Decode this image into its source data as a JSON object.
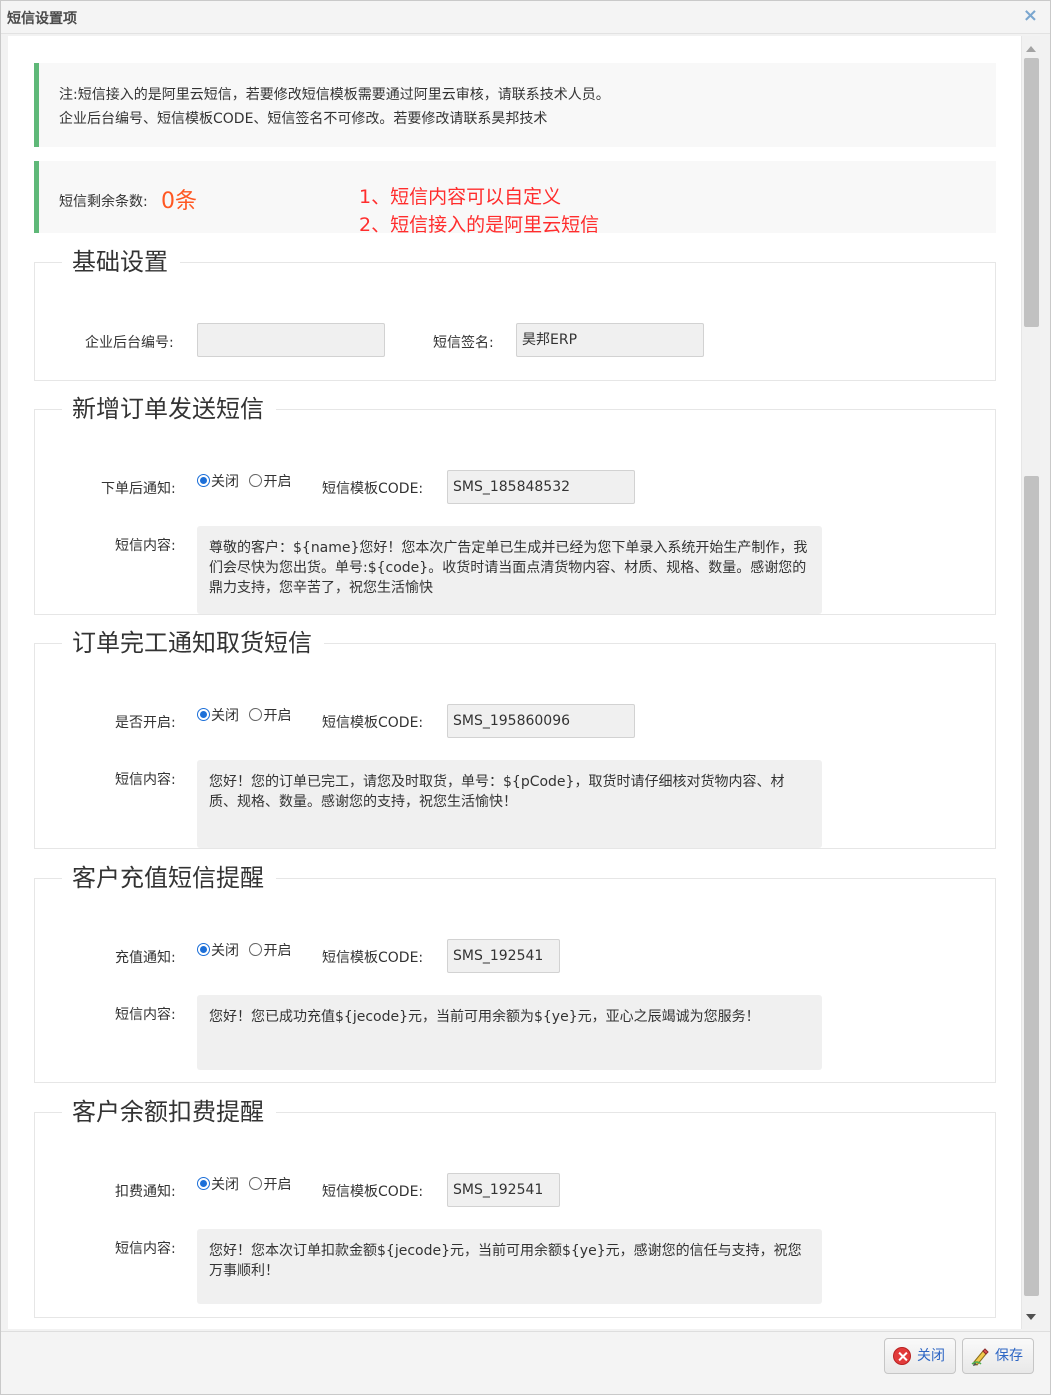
{
  "dialog": {
    "title": "短信设置项",
    "close_glyph": "×"
  },
  "notice": {
    "line1": "注:短信接入的是阿里云短信，若要修改短信模板需要通过阿里云审核，请联系技术人员。",
    "line2": "企业后台编号、短信模板CODE、短信签名不可修改。若要修改请联系昊邦技术",
    "remaining_label": "短信剩余条数:",
    "remaining_count": "0条",
    "red_note_1": "1、短信内容可以自定义",
    "red_note_2": "2、短信接入的是阿里云短信"
  },
  "sections": {
    "basic": {
      "legend": "基础设置",
      "company_id_label": "企业后台编号:",
      "company_id_value": "",
      "signature_label": "短信签名:",
      "signature_value": "昊邦ERP"
    },
    "new_order": {
      "legend": "新增订单发送短信",
      "toggle_label": "下单后通知:",
      "off_label": "关闭",
      "on_label": "开启",
      "code_label": "短信模板CODE:",
      "code_value": "SMS_185848532",
      "content_label": "短信内容:",
      "content": "尊敬的客户：${name}您好！您本次广告定单已生成并已经为您下单录入系统开始生产制作，我们会尽快为您出货。单号:${code}。收货时请当面点清货物内容、材质、规格、数量。感谢您的鼎力支持，您辛苦了，祝您生活愉快"
    },
    "order_done": {
      "legend": "订单完工通知取货短信",
      "toggle_label": "是否开启:",
      "off_label": "关闭",
      "on_label": "开启",
      "code_label": "短信模板CODE:",
      "code_value": "SMS_195860096",
      "content_label": "短信内容:",
      "content": "您好！您的订单已完工，请您及时取货，单号：${pCode}，取货时请仔细核对货物内容、材质、规格、数量。感谢您的支持，祝您生活愉快！"
    },
    "recharge": {
      "legend": "客户充值短信提醒",
      "toggle_label": "充值通知:",
      "off_label": "关闭",
      "on_label": "开启",
      "code_label": "短信模板CODE:",
      "code_value": "SMS_192541",
      "content_label": "短信内容:",
      "content": "您好！您已成功充值${jecode}元，当前可用余额为${ye}元，亚心之辰竭诚为您服务！"
    },
    "deduct": {
      "legend": "客户余额扣费提醒",
      "toggle_label": "扣费通知:",
      "off_label": "关闭",
      "on_label": "开启",
      "code_label": "短信模板CODE:",
      "code_value": "SMS_192541",
      "content_label": "短信内容:",
      "content": "您好！您本次订单扣款金额${jecode}元，当前可用余额${ye}元，感谢您的信任与支持，祝您万事顺利！"
    }
  },
  "footer": {
    "close_label": "关闭",
    "save_label": "保存"
  },
  "colors": {
    "accent_green": "#5fb878",
    "count_orange": "#ff5722",
    "note_red": "#ff2d2d",
    "button_text": "#2e66c4"
  }
}
